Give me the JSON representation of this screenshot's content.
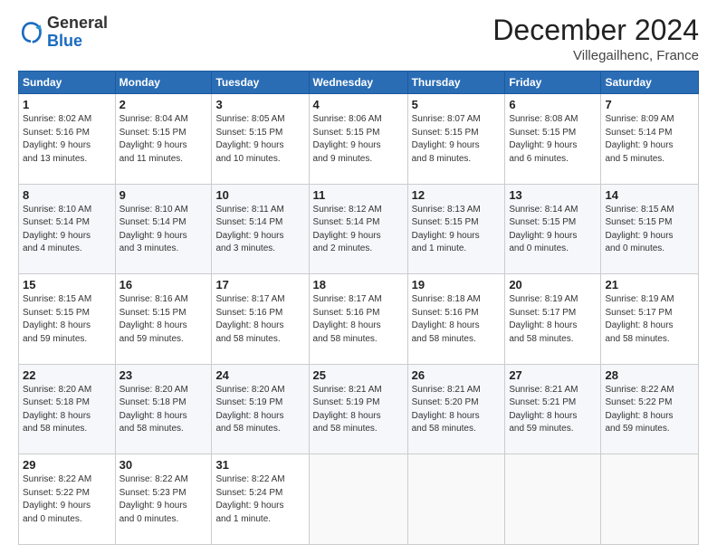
{
  "header": {
    "logo_general": "General",
    "logo_blue": "Blue",
    "month_title": "December 2024",
    "location": "Villegailhenc, France"
  },
  "weekdays": [
    "Sunday",
    "Monday",
    "Tuesday",
    "Wednesday",
    "Thursday",
    "Friday",
    "Saturday"
  ],
  "weeks": [
    [
      {
        "day": "1",
        "info": "Sunrise: 8:02 AM\nSunset: 5:16 PM\nDaylight: 9 hours\nand 13 minutes."
      },
      {
        "day": "2",
        "info": "Sunrise: 8:04 AM\nSunset: 5:15 PM\nDaylight: 9 hours\nand 11 minutes."
      },
      {
        "day": "3",
        "info": "Sunrise: 8:05 AM\nSunset: 5:15 PM\nDaylight: 9 hours\nand 10 minutes."
      },
      {
        "day": "4",
        "info": "Sunrise: 8:06 AM\nSunset: 5:15 PM\nDaylight: 9 hours\nand 9 minutes."
      },
      {
        "day": "5",
        "info": "Sunrise: 8:07 AM\nSunset: 5:15 PM\nDaylight: 9 hours\nand 8 minutes."
      },
      {
        "day": "6",
        "info": "Sunrise: 8:08 AM\nSunset: 5:15 PM\nDaylight: 9 hours\nand 6 minutes."
      },
      {
        "day": "7",
        "info": "Sunrise: 8:09 AM\nSunset: 5:14 PM\nDaylight: 9 hours\nand 5 minutes."
      }
    ],
    [
      {
        "day": "8",
        "info": "Sunrise: 8:10 AM\nSunset: 5:14 PM\nDaylight: 9 hours\nand 4 minutes."
      },
      {
        "day": "9",
        "info": "Sunrise: 8:10 AM\nSunset: 5:14 PM\nDaylight: 9 hours\nand 3 minutes."
      },
      {
        "day": "10",
        "info": "Sunrise: 8:11 AM\nSunset: 5:14 PM\nDaylight: 9 hours\nand 3 minutes."
      },
      {
        "day": "11",
        "info": "Sunrise: 8:12 AM\nSunset: 5:14 PM\nDaylight: 9 hours\nand 2 minutes."
      },
      {
        "day": "12",
        "info": "Sunrise: 8:13 AM\nSunset: 5:15 PM\nDaylight: 9 hours\nand 1 minute."
      },
      {
        "day": "13",
        "info": "Sunrise: 8:14 AM\nSunset: 5:15 PM\nDaylight: 9 hours\nand 0 minutes."
      },
      {
        "day": "14",
        "info": "Sunrise: 8:15 AM\nSunset: 5:15 PM\nDaylight: 9 hours\nand 0 minutes."
      }
    ],
    [
      {
        "day": "15",
        "info": "Sunrise: 8:15 AM\nSunset: 5:15 PM\nDaylight: 8 hours\nand 59 minutes."
      },
      {
        "day": "16",
        "info": "Sunrise: 8:16 AM\nSunset: 5:15 PM\nDaylight: 8 hours\nand 59 minutes."
      },
      {
        "day": "17",
        "info": "Sunrise: 8:17 AM\nSunset: 5:16 PM\nDaylight: 8 hours\nand 58 minutes."
      },
      {
        "day": "18",
        "info": "Sunrise: 8:17 AM\nSunset: 5:16 PM\nDaylight: 8 hours\nand 58 minutes."
      },
      {
        "day": "19",
        "info": "Sunrise: 8:18 AM\nSunset: 5:16 PM\nDaylight: 8 hours\nand 58 minutes."
      },
      {
        "day": "20",
        "info": "Sunrise: 8:19 AM\nSunset: 5:17 PM\nDaylight: 8 hours\nand 58 minutes."
      },
      {
        "day": "21",
        "info": "Sunrise: 8:19 AM\nSunset: 5:17 PM\nDaylight: 8 hours\nand 58 minutes."
      }
    ],
    [
      {
        "day": "22",
        "info": "Sunrise: 8:20 AM\nSunset: 5:18 PM\nDaylight: 8 hours\nand 58 minutes."
      },
      {
        "day": "23",
        "info": "Sunrise: 8:20 AM\nSunset: 5:18 PM\nDaylight: 8 hours\nand 58 minutes."
      },
      {
        "day": "24",
        "info": "Sunrise: 8:20 AM\nSunset: 5:19 PM\nDaylight: 8 hours\nand 58 minutes."
      },
      {
        "day": "25",
        "info": "Sunrise: 8:21 AM\nSunset: 5:19 PM\nDaylight: 8 hours\nand 58 minutes."
      },
      {
        "day": "26",
        "info": "Sunrise: 8:21 AM\nSunset: 5:20 PM\nDaylight: 8 hours\nand 58 minutes."
      },
      {
        "day": "27",
        "info": "Sunrise: 8:21 AM\nSunset: 5:21 PM\nDaylight: 8 hours\nand 59 minutes."
      },
      {
        "day": "28",
        "info": "Sunrise: 8:22 AM\nSunset: 5:22 PM\nDaylight: 8 hours\nand 59 minutes."
      }
    ],
    [
      {
        "day": "29",
        "info": "Sunrise: 8:22 AM\nSunset: 5:22 PM\nDaylight: 9 hours\nand 0 minutes."
      },
      {
        "day": "30",
        "info": "Sunrise: 8:22 AM\nSunset: 5:23 PM\nDaylight: 9 hours\nand 0 minutes."
      },
      {
        "day": "31",
        "info": "Sunrise: 8:22 AM\nSunset: 5:24 PM\nDaylight: 9 hours\nand 1 minute."
      },
      {
        "day": "",
        "info": ""
      },
      {
        "day": "",
        "info": ""
      },
      {
        "day": "",
        "info": ""
      },
      {
        "day": "",
        "info": ""
      }
    ]
  ]
}
